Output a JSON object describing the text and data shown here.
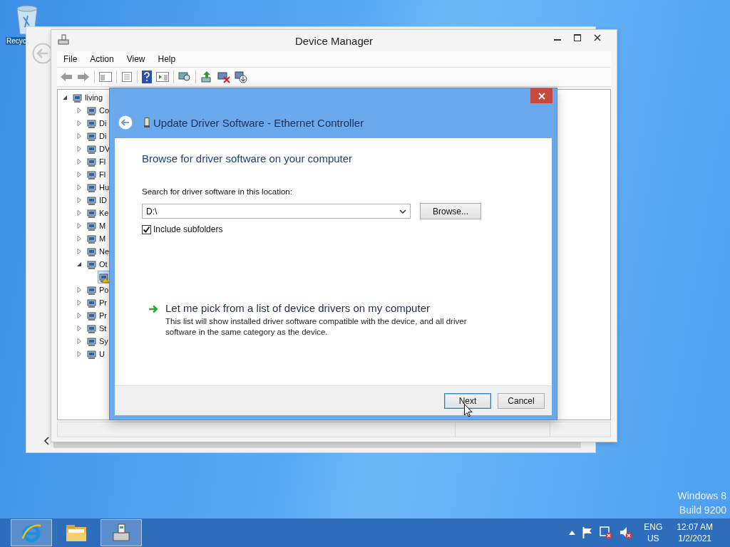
{
  "desktop": {
    "icons": [
      {
        "label": "Recyc"
      }
    ],
    "edition": [
      "Windows 8",
      "Build 9200"
    ]
  },
  "device_manager": {
    "title": "Device Manager",
    "menu": [
      "File",
      "Action",
      "View",
      "Help"
    ],
    "tree": {
      "label": "living",
      "expanded": true,
      "selected": false,
      "children": [
        {
          "label": "Co",
          "expanded": false,
          "selected": false
        },
        {
          "label": "Di",
          "expanded": false,
          "selected": false
        },
        {
          "label": "Di",
          "expanded": false,
          "selected": false
        },
        {
          "label": "DV",
          "expanded": false,
          "selected": false
        },
        {
          "label": "Fl",
          "expanded": false,
          "selected": false
        },
        {
          "label": "Fl",
          "expanded": false,
          "selected": false
        },
        {
          "label": "Hu",
          "expanded": false,
          "selected": false
        },
        {
          "label": "ID",
          "expanded": false,
          "selected": false
        },
        {
          "label": "Ke",
          "expanded": false,
          "selected": false
        },
        {
          "label": "M",
          "expanded": false,
          "selected": false
        },
        {
          "label": "M",
          "expanded": false,
          "selected": false
        },
        {
          "label": "Ne",
          "expanded": false,
          "selected": false
        },
        {
          "label": "Ot",
          "expanded": true,
          "selected": false,
          "children": [
            {
              "selected": true,
              "warning": true
            }
          ]
        },
        {
          "label": "Po",
          "expanded": false,
          "selected": false
        },
        {
          "label": "Pr",
          "expanded": false,
          "selected": false
        },
        {
          "label": "Pr",
          "expanded": false,
          "selected": false
        },
        {
          "label": "St",
          "expanded": false,
          "selected": false
        },
        {
          "label": "Sy",
          "expanded": false,
          "selected": false
        },
        {
          "label": "U",
          "expanded": false,
          "selected": false
        }
      ]
    }
  },
  "dialog": {
    "title": "Update Driver Software - Ethernet Controller",
    "heading": "Browse for driver software on your computer",
    "location_label": "Search for driver software in this location:",
    "location_value": "D:\\",
    "browse_button": "Browse...",
    "include_subfolders": {
      "label": "Include subfolders",
      "checked": true
    },
    "link": {
      "label": "Let me pick from a list of device drivers on my computer",
      "description": "This list will show installed driver software compatible with the device, and all driver software in the same category as the device."
    },
    "buttons": [
      {
        "label": "Next",
        "default": true
      },
      {
        "label": "Cancel",
        "default": false
      }
    ]
  },
  "taskbar": {
    "apps": [
      {
        "kind": "browser",
        "highlighted": true
      },
      {
        "kind": "folder",
        "highlighted": false
      },
      {
        "kind": "device-manager",
        "highlighted": true
      }
    ],
    "language": [
      "ENG",
      "US"
    ],
    "time": "12:07 AM",
    "date": "1/2/2021"
  }
}
